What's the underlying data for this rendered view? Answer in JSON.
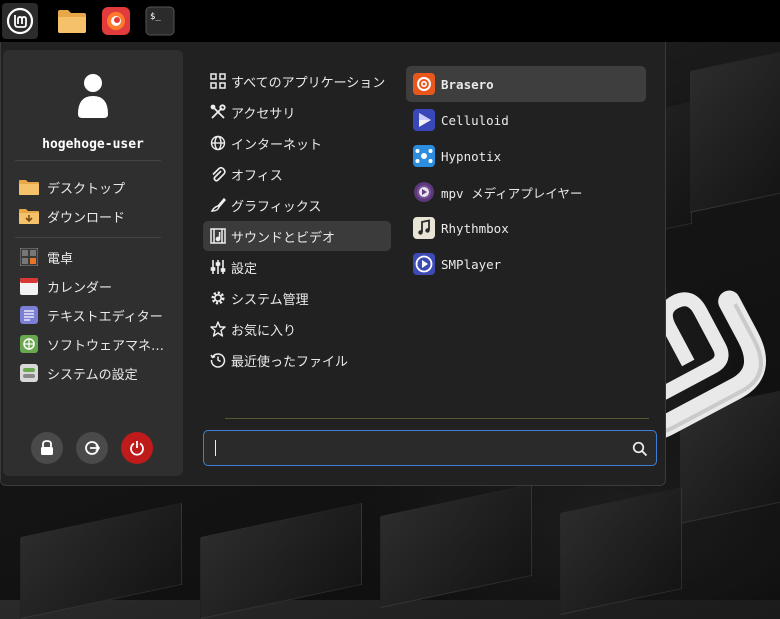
{
  "panel": {
    "items": [
      {
        "name": "menu-button",
        "icon": "mint-logo-icon"
      },
      {
        "name": "files-launcher",
        "icon": "folder-icon"
      },
      {
        "name": "firefox-launcher",
        "icon": "firefox-icon"
      },
      {
        "name": "terminal-launcher",
        "icon": "terminal-icon",
        "text": "$_"
      }
    ]
  },
  "user": {
    "name": "hogehoge-user"
  },
  "places": [
    {
      "label": "デスクトップ",
      "icon": "folder-icon"
    },
    {
      "label": "ダウンロード",
      "icon": "download-folder-icon"
    }
  ],
  "favorites": [
    {
      "label": "電卓",
      "icon": "calculator-icon"
    },
    {
      "label": "カレンダー",
      "icon": "calendar-icon"
    },
    {
      "label": "テキストエディター",
      "icon": "text-editor-icon"
    },
    {
      "label": "ソフトウェアマネ…",
      "icon": "software-manager-icon"
    },
    {
      "label": "システムの設定",
      "icon": "system-settings-icon"
    }
  ],
  "session_buttons": [
    {
      "name": "lock-screen-button",
      "icon": "lock-icon"
    },
    {
      "name": "logout-button",
      "icon": "logout-icon"
    },
    {
      "name": "shutdown-button",
      "icon": "power-icon"
    }
  ],
  "categories": [
    {
      "label": "すべてのアプリケーション",
      "icon": "all-apps-icon"
    },
    {
      "label": "アクセサリ",
      "icon": "accessories-icon"
    },
    {
      "label": "インターネット",
      "icon": "globe-icon"
    },
    {
      "label": "オフィス",
      "icon": "paperclip-icon"
    },
    {
      "label": "グラフィックス",
      "icon": "graphics-icon"
    },
    {
      "label": "サウンドとビデオ",
      "icon": "sound-video-icon",
      "active": true
    },
    {
      "label": "設定",
      "icon": "sliders-icon"
    },
    {
      "label": "システム管理",
      "icon": "gear-icon"
    },
    {
      "label": "お気に入り",
      "icon": "star-icon"
    },
    {
      "label": "最近使ったファイル",
      "icon": "history-icon"
    }
  ],
  "apps": [
    {
      "label": "Brasero",
      "icon": "brasero-icon",
      "active": true
    },
    {
      "label": "Celluloid",
      "icon": "celluloid-icon"
    },
    {
      "label": "Hypnotix",
      "icon": "hypnotix-icon"
    },
    {
      "label": "mpv メディアプレイヤー",
      "icon": "mpv-icon"
    },
    {
      "label": "Rhythmbox",
      "icon": "rhythmbox-icon"
    },
    {
      "label": "SMPlayer",
      "icon": "smplayer-icon"
    }
  ],
  "search": {
    "value": "",
    "placeholder": "",
    "icon": "search-icon"
  },
  "colors": {
    "accent": "#3d7fd8",
    "power": "#c01b1b",
    "active_row": "#3e3e3e"
  }
}
